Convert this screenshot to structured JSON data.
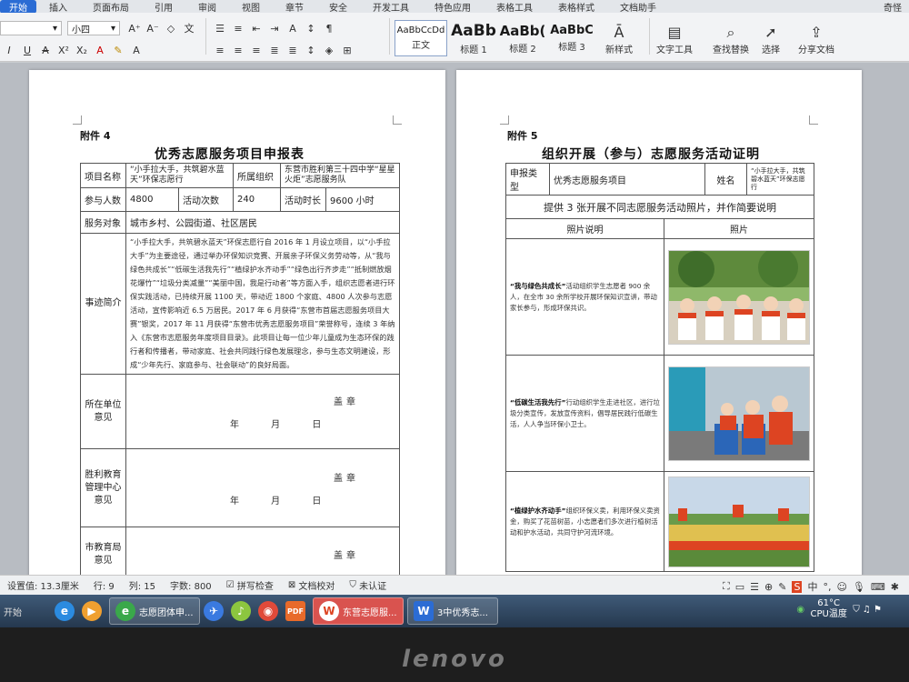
{
  "menu": {
    "items": [
      "开始",
      "插入",
      "页面布局",
      "引用",
      "审阅",
      "视图",
      "章节",
      "安全",
      "开发工具",
      "特色应用",
      "表格工具",
      "表格样式",
      "文档助手"
    ],
    "active_index": 0,
    "right": "奇怪"
  },
  "ribbon": {
    "font_size": "小四",
    "styles": [
      {
        "sample": "AaBbCcDd",
        "caption": "正文"
      },
      {
        "sample": "AaBb",
        "caption": "标题 1"
      },
      {
        "sample": "AaBb(",
        "caption": "标题 2"
      },
      {
        "sample": "AaBbC",
        "caption": "标题 3"
      }
    ],
    "new_style": "新样式",
    "text_tools": "文字工具",
    "find_replace": "查找替换",
    "select": "选择",
    "share": "分享文档"
  },
  "left_page": {
    "attachment": "附件 4",
    "title": "优秀志愿服务项目申报表",
    "project_name_label": "项目名称",
    "project_name": "“小手拉大手，共筑碧水蓝天”环保志愿行",
    "org_label": "所属组织",
    "org": "东营市胜利第三十四中学“星星火炬”志愿服务队",
    "participants_label": "参与人数",
    "participants": "4800",
    "activities_label": "活动次数",
    "activities": "240",
    "hours_label": "活动时长",
    "hours": "9600 小时",
    "target_label": "服务对象",
    "target": "城市乡村、公园街道、社区居民",
    "summary_label": "事迹简介",
    "summary": "“小手拉大手，共筑碧水蓝天”环保志愿行自 2016 年 1 月设立项目，以“小手拉大手”为主要途径，通过举办环保知识竞赛、开展亲子环保义务劳动等，从“我与绿色共成长”“低碳生活我先行”“植绿护水齐动手”“绿色出行齐步走”“抵制燃放烟花爆竹”“垃圾分类减量”“美丽中国，我是行动者”等方面入手，组织志愿者进行环保实践活动，已持续开展 1100 天，带动近 1800 个家庭、4800 人次参与志愿活动，宣传影响近 6.5 万居民。2017 年 6 月获得“东营市首届志愿服务项目大赛”银奖，2017 年 11 月获得“东营市优秀志愿服务项目”荣誉称号，连续 3 年纳入《东营市志愿服务年度项目目录》。此项目让每一位少年儿童成为生态环保的践行者和传播者，带动家庭、社会共同践行绿色发展理念，参与生态文明建设，形成“少年先行、家庭参与、社会联动”的良好局面。",
    "unit_opinion_label": "所在单位意见",
    "edu_opinion_label": "胜利教育管理中心意见",
    "city_opinion_label": "市教育局意见",
    "sign": "盖章",
    "date": "年 月 日"
  },
  "right_page": {
    "attachment": "附件 5",
    "title": "组织开展（参与）志愿服务活动证明",
    "type_label": "申报类型",
    "type": "优秀志愿服务项目",
    "name_label": "姓名",
    "name": "“小手拉大手，共筑碧水蓝天”环保志愿行",
    "instruction": "提供 3 张开展不同志愿服务活动照片，并作简要说明",
    "col_desc": "照片说明",
    "col_photo": "照片",
    "rows": [
      {
        "heading": "“我与绿色共成长”",
        "text": "活动组织学生志愿者 900 余人，在全市 30 余所学校开展环保知识宣讲，带动家长参与，形成环保共识。"
      },
      {
        "heading": "“低碳生活我先行”",
        "text": "行动组织学生走进社区，进行垃圾分类宣传，发放宣传资料，倡导居民践行低碳生活，人人争当环保小卫士。"
      },
      {
        "heading": "“植绿护水齐动手”",
        "text": "组织环保义卖，利用环保义卖资金，购买了花苗树苗，小志愿者们多次进行植树活动和护水活动，共同守护河流环境。"
      }
    ]
  },
  "status": {
    "settings": "设置值: 13.3厘米",
    "row": "行: 9",
    "col": "列: 15",
    "words": "字数: 800",
    "spell": "拼写检查",
    "proof": "文档校对",
    "cert": "未认证"
  },
  "taskbar": {
    "start": "开始",
    "windows": [
      "志愿团体申...",
      "东营志愿服...",
      "3中优秀志..."
    ],
    "temp": "61°C",
    "cpu": "CPU温度"
  },
  "brand": "lenovo",
  "colors": {
    "accent": "#2b6cd4",
    "taskbar": "#2f4560"
  }
}
